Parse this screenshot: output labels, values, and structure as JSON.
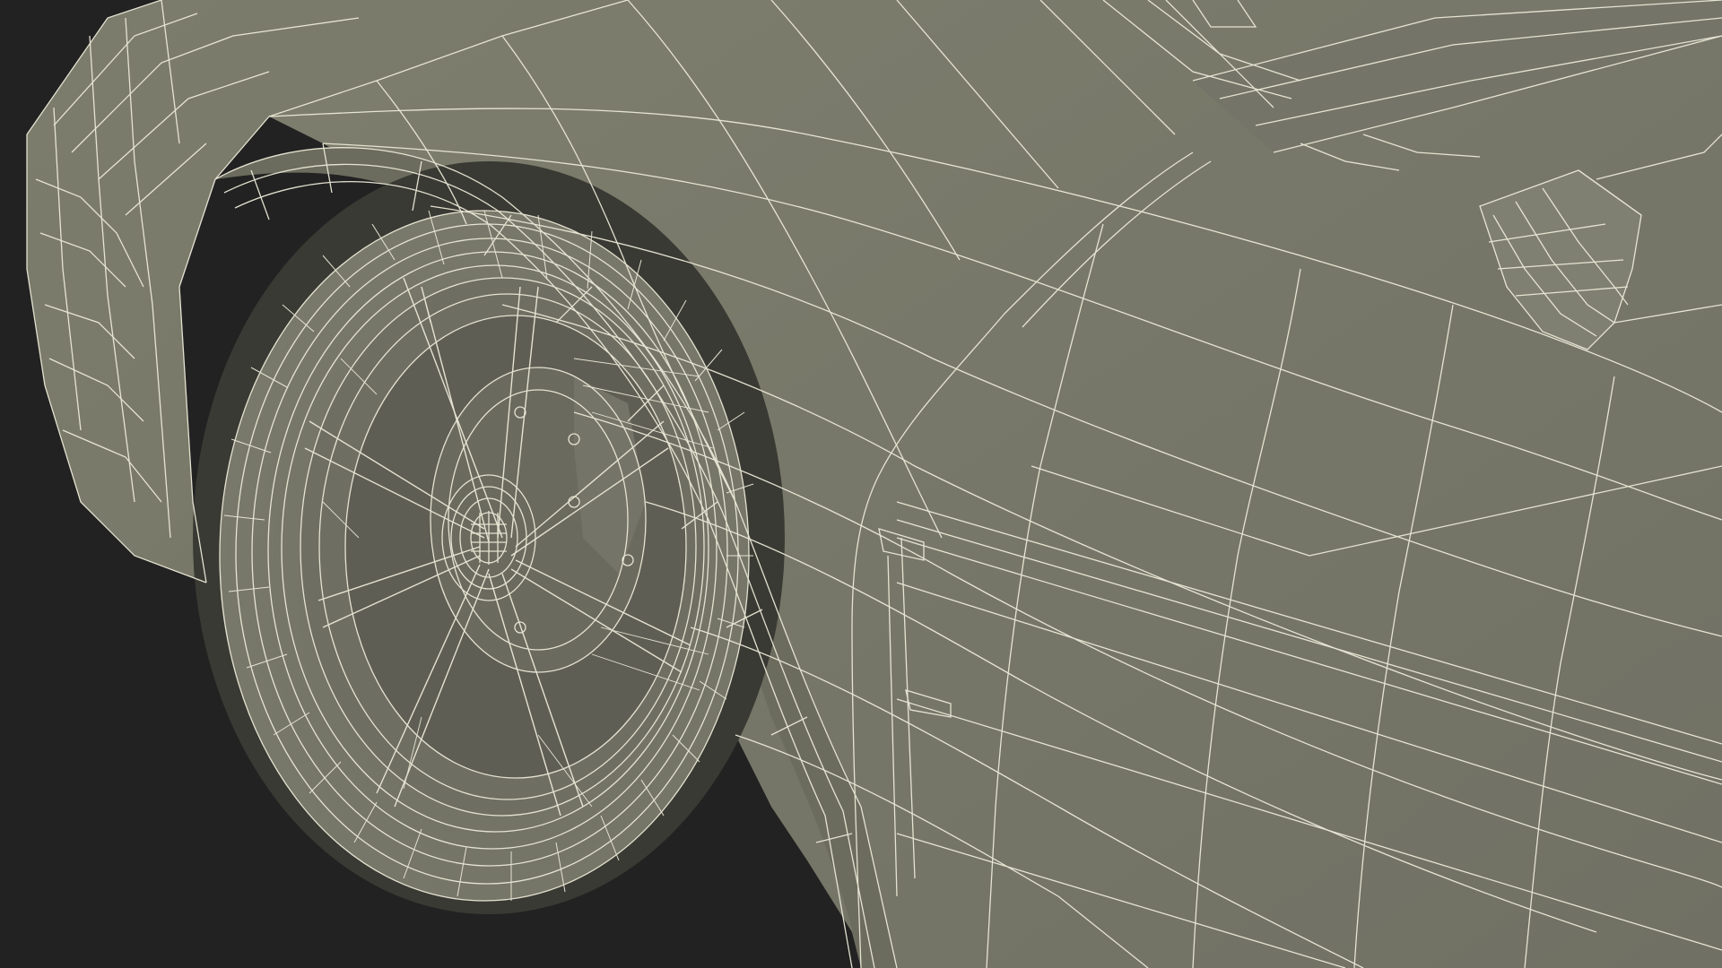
{
  "scene": {
    "subject": "car-front-wheel-wireframe-render",
    "colors": {
      "background": "#222222",
      "surface": "#7a7a6a",
      "surface_shadow": "#66665a",
      "surface_light": "#85857a",
      "tire": "#747466",
      "rim": "#6e6e62",
      "well": "#3a3a34",
      "wire": "#ecead8"
    }
  }
}
